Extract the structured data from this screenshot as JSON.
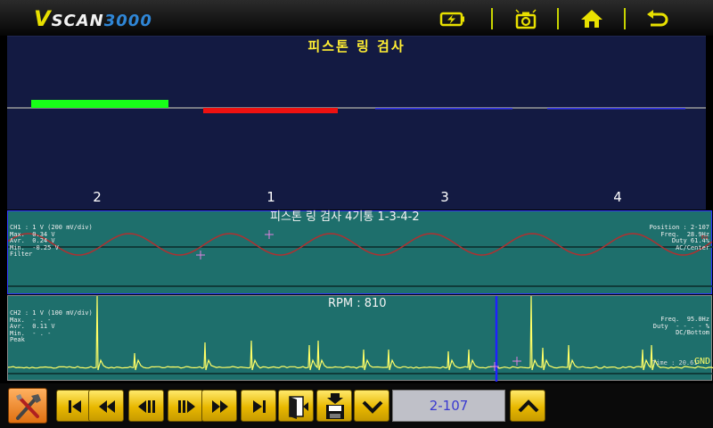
{
  "app": {
    "logo_v": "V",
    "logo_scan": "SCAN",
    "logo_num": "3000"
  },
  "topbar": {
    "icons": [
      "battery-icon",
      "camera-icon",
      "home-icon",
      "back-icon"
    ]
  },
  "panel": {
    "title": "피스톤 링 검사",
    "bars": [
      {
        "cylinder": "2",
        "level": "high",
        "color": "#18ff18"
      },
      {
        "cylinder": "1",
        "level": "low",
        "color": "#ee1111"
      },
      {
        "cylinder": "3",
        "level": "baseline",
        "color": "#3a3af0"
      },
      {
        "cylinder": "4",
        "level": "baseline",
        "color": "#3a3af0"
      }
    ]
  },
  "ch1": {
    "title": "피스톤 링 검사 4기통 1-3-4-2",
    "left_info": [
      "CH1 : 1 V (200 mV/div)",
      "Max.  0.34 V",
      "Avr.  0.24 V",
      "Min.  -0.25 V",
      "Filter"
    ],
    "right_info": [
      "Position : 2-107",
      "Freq.  28.9Hz",
      "Duty 61.4%",
      "AC/Center"
    ],
    "edge_label": "ms",
    "wave_color": "#b03030",
    "cycles": 7
  },
  "ch2": {
    "title": "RPM : 810",
    "left_info": [
      "CH2 : 1 V (100 mV/div)",
      "Max.  - . -",
      "Avr.  0.11 V",
      "Min.  - . -",
      "Peak"
    ],
    "right_info": [
      "Freq.  95.0Hz",
      "Duty  - - . - %",
      "DC/Bottom"
    ],
    "time_label": "Time : 20.61",
    "gnd_label": "GND",
    "trace_color": "#ffff66",
    "cursor_color": "#2020ff"
  },
  "toolbar": {
    "buttons": [
      "first-icon",
      "rewind-icon",
      "step-back-icon",
      "step-forward-icon",
      "fast-forward-icon",
      "last-icon",
      "exit-icon",
      "save-icon",
      "down-icon",
      "up-icon"
    ],
    "page": "2-107"
  }
}
